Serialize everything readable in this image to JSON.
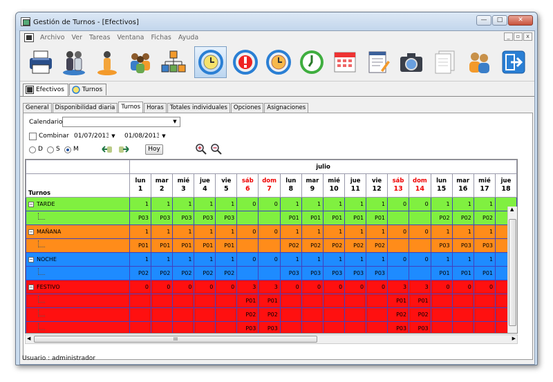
{
  "window": {
    "title": "Gestión de Turnos - [Efectivos]",
    "min": "—",
    "max": "□",
    "close": "✕"
  },
  "menu": [
    "Archivo",
    "Ver",
    "Tareas",
    "Ventana",
    "Fichas",
    "Ayuda"
  ],
  "mdi": {
    "min": "_",
    "restore": "▫",
    "close": "x"
  },
  "toolbar": [
    {
      "name": "printer-icon"
    },
    {
      "name": "people-icon"
    },
    {
      "name": "person-icon"
    },
    {
      "name": "group-icon"
    },
    {
      "name": "org-chart-icon"
    },
    {
      "name": "clock-refresh-icon",
      "active": true
    },
    {
      "name": "alert-clock-icon"
    },
    {
      "name": "clock-sync-icon"
    },
    {
      "name": "green-clock-icon"
    },
    {
      "name": "calendar-icon"
    },
    {
      "name": "notepad-icon"
    },
    {
      "name": "camera-icon"
    },
    {
      "name": "documents-icon"
    },
    {
      "name": "users-icon"
    },
    {
      "name": "exit-icon"
    }
  ],
  "doc_tabs": [
    "Efectivos",
    "Turnos"
  ],
  "sub_tabs": [
    "General",
    "Disponibilidad diaria",
    "Turnos",
    "Horas",
    "Totales individuales",
    "Opciones",
    "Asignaciones"
  ],
  "form": {
    "calendario_label": "Calendario",
    "calendario_value": "",
    "combinar_label": "Combinar",
    "date_from": "01/07/2013",
    "date_to": "01/08/2013",
    "radio_d": "D",
    "radio_s": "S",
    "radio_m": "M",
    "hoy_button": "Hoy"
  },
  "grid": {
    "month": "julio",
    "turnos_header": "Turnos",
    "days": [
      {
        "dow": "lun",
        "d": "1"
      },
      {
        "dow": "mar",
        "d": "2"
      },
      {
        "dow": "mié",
        "d": "3"
      },
      {
        "dow": "jue",
        "d": "4"
      },
      {
        "dow": "vie",
        "d": "5"
      },
      {
        "dow": "sáb",
        "d": "6",
        "we": true
      },
      {
        "dow": "dom",
        "d": "7",
        "we": true
      },
      {
        "dow": "lun",
        "d": "8"
      },
      {
        "dow": "mar",
        "d": "9"
      },
      {
        "dow": "mié",
        "d": "10"
      },
      {
        "dow": "jue",
        "d": "11"
      },
      {
        "dow": "vie",
        "d": "12"
      },
      {
        "dow": "sáb",
        "d": "13",
        "we": true
      },
      {
        "dow": "dom",
        "d": "14",
        "we": true
      },
      {
        "dow": "lun",
        "d": "15"
      },
      {
        "dow": "mar",
        "d": "16"
      },
      {
        "dow": "mié",
        "d": "17"
      },
      {
        "dow": "jue",
        "d": "18"
      }
    ],
    "groups": [
      {
        "name": "TARDE",
        "color": "green",
        "counts": [
          "1",
          "1",
          "1",
          "1",
          "1",
          "0",
          "0",
          "1",
          "1",
          "1",
          "1",
          "1",
          "0",
          "0",
          "1",
          "1",
          "1",
          ""
        ],
        "rows": [
          [
            "P03",
            "P03",
            "P03",
            "P03",
            "P03",
            "",
            "",
            "P01",
            "P01",
            "P01",
            "P01",
            "P01",
            "",
            "",
            "P02",
            "P02",
            "P02",
            ""
          ]
        ]
      },
      {
        "name": "MAÑANA",
        "color": "orange",
        "counts": [
          "1",
          "1",
          "1",
          "1",
          "1",
          "0",
          "0",
          "1",
          "1",
          "1",
          "1",
          "1",
          "0",
          "0",
          "1",
          "1",
          "1",
          ""
        ],
        "rows": [
          [
            "P01",
            "P01",
            "P01",
            "P01",
            "P01",
            "",
            "",
            "P02",
            "P02",
            "P02",
            "P02",
            "P02",
            "",
            "",
            "P03",
            "P03",
            "P03",
            ""
          ]
        ]
      },
      {
        "name": "NOCHE",
        "color": "blue",
        "counts": [
          "1",
          "1",
          "1",
          "1",
          "1",
          "0",
          "0",
          "1",
          "1",
          "1",
          "1",
          "1",
          "0",
          "0",
          "1",
          "1",
          "1",
          ""
        ],
        "rows": [
          [
            "P02",
            "P02",
            "P02",
            "P02",
            "P02",
            "",
            "",
            "P03",
            "P03",
            "P03",
            "P03",
            "P03",
            "",
            "",
            "P01",
            "P01",
            "P01",
            ""
          ]
        ]
      },
      {
        "name": "FESTIVO",
        "color": "red",
        "counts": [
          "0",
          "0",
          "0",
          "0",
          "0",
          "3",
          "3",
          "0",
          "0",
          "0",
          "0",
          "0",
          "3",
          "3",
          "0",
          "0",
          "0",
          ""
        ],
        "rows": [
          [
            "",
            "",
            "",
            "",
            "",
            "P01",
            "P01",
            "",
            "",
            "",
            "",
            "",
            "P01",
            "P01",
            "",
            "",
            "",
            ""
          ],
          [
            "",
            "",
            "",
            "",
            "",
            "P02",
            "P02",
            "",
            "",
            "",
            "",
            "",
            "P02",
            "P02",
            "",
            "",
            "",
            ""
          ],
          [
            "",
            "",
            "",
            "",
            "",
            "P03",
            "P03",
            "",
            "",
            "",
            "",
            "",
            "P03",
            "P03",
            "",
            "",
            "",
            ""
          ]
        ]
      }
    ],
    "hscroll_grip": "III"
  },
  "status": "Usuario : administrador"
}
